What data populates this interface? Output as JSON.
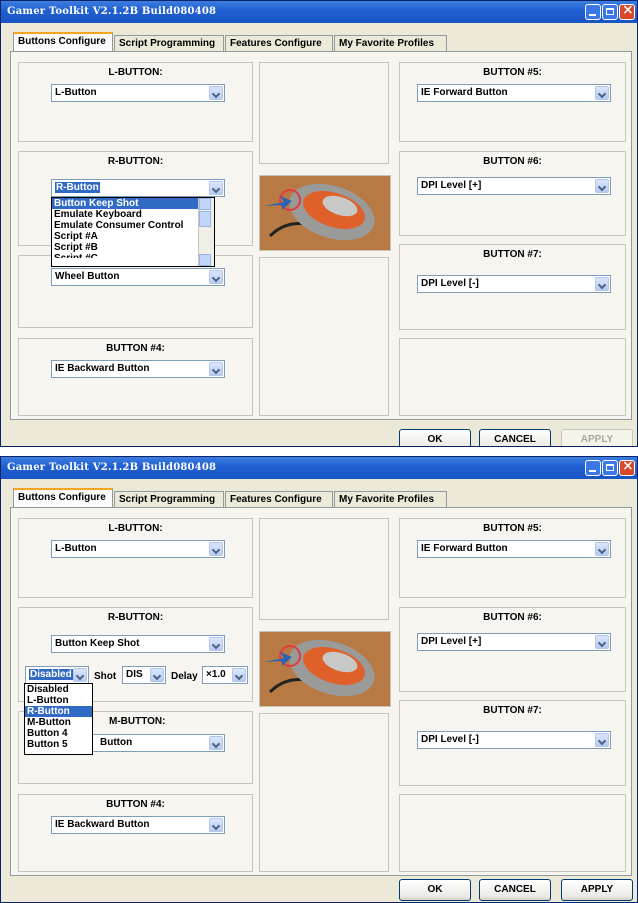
{
  "window_title": "Gamer Toolkit V2.1.2B Build080408",
  "tabs": [
    "Buttons Configure",
    "Script Programming",
    "Features Configure",
    "My Favorite Profiles"
  ],
  "labels": {
    "l_button": "L-BUTTON:",
    "r_button": "R-BUTTON:",
    "m_button": "M-BUTTON:",
    "button4": "BUTTON #4:",
    "button5": "BUTTON #5:",
    "button6": "BUTTON #6:",
    "button7": "BUTTON #7:"
  },
  "values": {
    "l_button": "L-Button",
    "m_button": "Wheel Button",
    "button4": "IE Backward Button",
    "button5": "IE Forward Button",
    "button6": "DPI Level [+]",
    "button7": "DPI Level [-]"
  },
  "footer": {
    "ok": "OK",
    "cancel": "CANCEL",
    "apply": "APPLY"
  },
  "screen1": {
    "r_button_value": "R-Button",
    "r_dropdown_options": [
      "Button Keep Shot",
      "Emulate Keyboard",
      "Emulate Consumer Control",
      "Script #A",
      "Script #B",
      "Script #C"
    ],
    "r_dropdown_highlight": "Button Keep Shot",
    "apply_enabled": false
  },
  "screen2": {
    "r_button_value": "Button Keep Shot",
    "keep_shot": {
      "source_value": "Disabled",
      "shot_label": "Shot",
      "shot_value": "DIS",
      "delay_label": "Delay",
      "delay_value": "×1.0"
    },
    "source_dropdown_options": [
      "Disabled",
      "L-Button",
      "R-Button",
      "M-Button",
      "Button 4",
      "Button 5"
    ],
    "source_dropdown_highlight": "R-Button",
    "m_button_partial": "Button",
    "apply_enabled": true
  }
}
